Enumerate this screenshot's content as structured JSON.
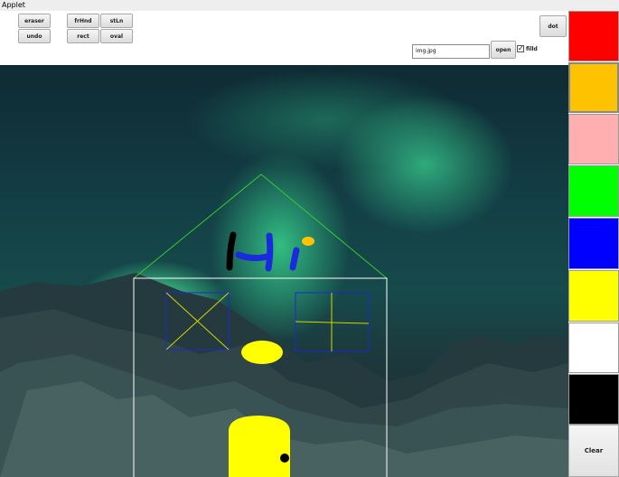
{
  "window": {
    "title": "Applet"
  },
  "toolbar": {
    "eraser_label": "eraser",
    "undo_label": "undo",
    "freehand_label": "frHnd",
    "rect_label": "rect",
    "straight_line_label": "stLn",
    "oval_label": "oval",
    "dot_label": "dot",
    "file_input_value": "img.jpg",
    "open_label": "open",
    "filled_label": "filld",
    "filled_checked": true
  },
  "palette": {
    "colors": [
      "#ff0000",
      "#ffc200",
      "#ffafaf",
      "#00ff00",
      "#0000ff",
      "#ffff00",
      "#ffffff",
      "#000000"
    ],
    "selected": "#ffc200",
    "clear_label": "Clear"
  },
  "canvas": {
    "drawing_text": "Hi",
    "background_image": "aurora over snowy mountains"
  }
}
